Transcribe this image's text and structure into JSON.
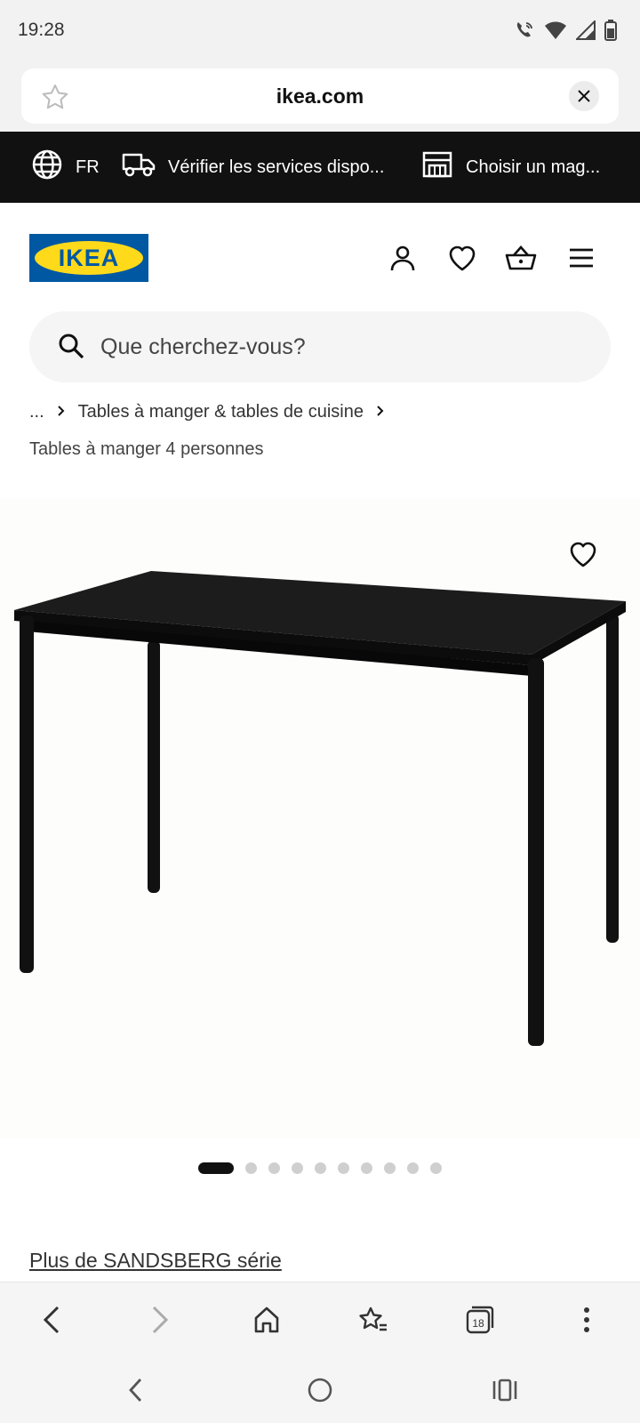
{
  "status": {
    "time": "19:28",
    "icons": [
      "wifi-call-icon",
      "wifi-icon",
      "signal-icon",
      "battery-icon"
    ]
  },
  "browser": {
    "url": "ikea.com"
  },
  "info_bar": {
    "language": "FR",
    "delivery": "Vérifier les services dispo...",
    "store": "Choisir un mag..."
  },
  "header": {
    "logo_text": "IKEA",
    "icons": [
      "account-icon",
      "heart-icon",
      "basket-icon",
      "menu-icon"
    ]
  },
  "search": {
    "placeholder": "Que cherchez-vous?"
  },
  "breadcrumb": {
    "ellipsis": "...",
    "category": "Tables à manger & tables de cuisine",
    "subcategory": "Tables à manger 4 personnes"
  },
  "gallery": {
    "total_images": 10,
    "active_index": 0
  },
  "series_link": "Plus de SANDSBERG série",
  "colors": {
    "ikea_blue": "#0058a3",
    "ikea_yellow": "#ffda1a",
    "info_bar_bg": "#111111"
  }
}
